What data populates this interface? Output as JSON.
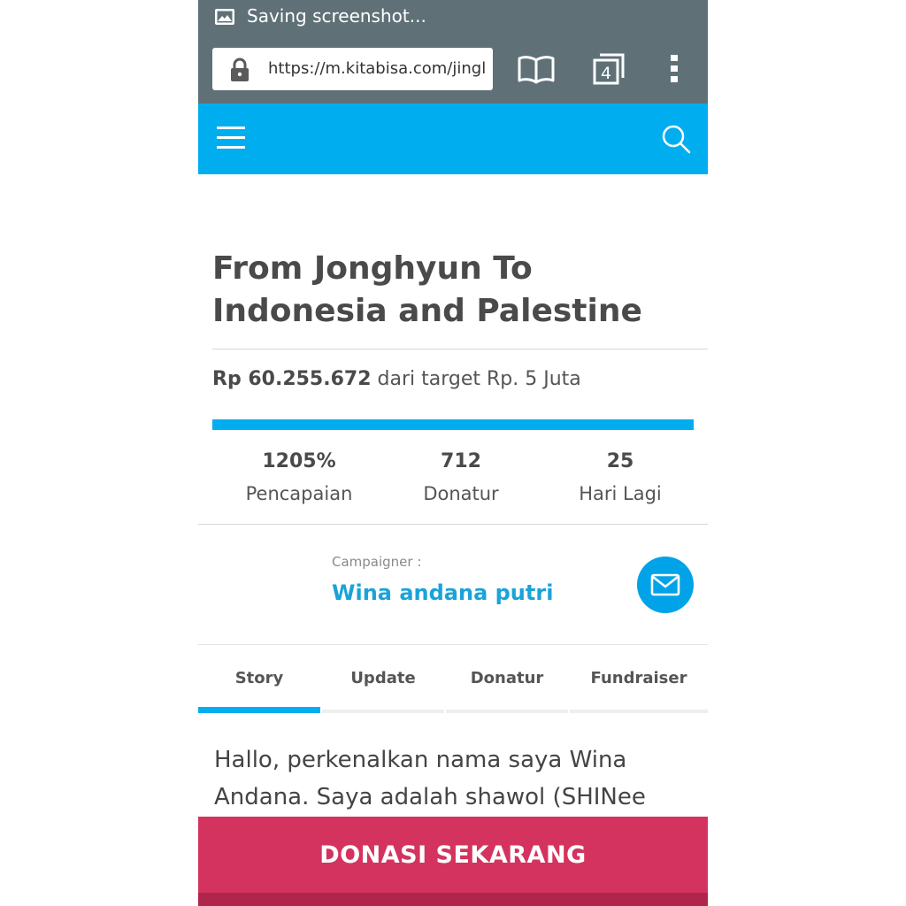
{
  "status_bar": {
    "icon": "image-icon",
    "text": "Saving screenshot..."
  },
  "browser": {
    "url": "https://m.kitabisa.com/jingl",
    "lock_icon": "lock-icon",
    "bookmarks_icon": "open-book-icon",
    "tab_count": "4",
    "menu_icon": "vertical-dots-icon"
  },
  "site_header": {
    "background": "#00aeef",
    "menu_icon": "hamburger-icon",
    "search_icon": "search-icon"
  },
  "campaign": {
    "title": "From Jonghyun To Indonesia and Palestine",
    "amount": "Rp 60.255.672",
    "target_text": "dari target Rp. 5 Juta",
    "progress_fraction": 1.0,
    "stats": [
      {
        "value": "1205%",
        "label": "Pencapaian"
      },
      {
        "value": "712",
        "label": "Donatur"
      },
      {
        "value": "25",
        "label": "Hari Lagi"
      }
    ],
    "campaigner_label": "Campaigner :",
    "campaigner_name": "Wina andana putri",
    "mail_icon": "envelope-icon"
  },
  "tabs": [
    {
      "label": "Story",
      "active": true
    },
    {
      "label": "Update",
      "active": false
    },
    {
      "label": "Donatur",
      "active": false
    },
    {
      "label": "Fundraiser",
      "active": false
    }
  ],
  "story": {
    "text": "Hallo, perkenalkan nama saya Wina Andana. Saya adalah shawol (SHINee"
  },
  "donate_button": {
    "label": "DONASI SEKARANG",
    "color": "#d4335f"
  }
}
